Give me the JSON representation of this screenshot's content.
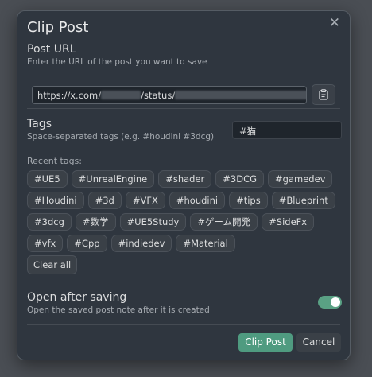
{
  "modal": {
    "title": "Clip Post",
    "close_icon": "close-icon",
    "close_glyph": "✕"
  },
  "url_section": {
    "heading": "Post URL",
    "description": "Enter the URL of the post you want to save",
    "value_prefix": "https://x.com/",
    "value_middle": "/status/",
    "paste_icon": "clipboard-icon"
  },
  "tags_section": {
    "heading": "Tags",
    "description": "Space-separated tags (e.g. #houdini #3dcg)",
    "input_value": "#猫"
  },
  "recent_tags": {
    "label": "Recent tags:",
    "items": [
      "#UE5",
      "#UnrealEngine",
      "#shader",
      "#3DCG",
      "#gamedev",
      "#Houdini",
      "#3d",
      "#VFX",
      "#houdini",
      "#tips",
      "#Blueprint",
      "#3dcg",
      "#数学",
      "#UE5Study",
      "#ゲーム開発",
      "#SideFx",
      "#vfx",
      "#Cpp",
      "#indiedev",
      "#Material"
    ],
    "clear_label": "Clear all"
  },
  "open_after": {
    "heading": "Open after saving",
    "description": "Open the saved post note after it is created",
    "enabled": true
  },
  "footer": {
    "primary_label": "Clip Post",
    "cancel_label": "Cancel"
  },
  "colors": {
    "accent": "#4f9b80",
    "background": "#2f363f"
  }
}
